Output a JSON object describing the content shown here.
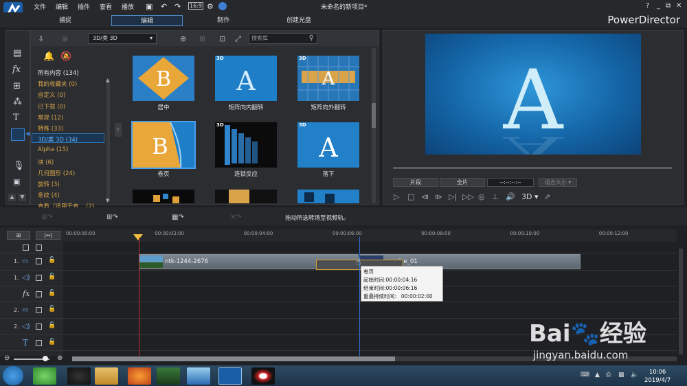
{
  "app": {
    "title": "未命名的新项目*",
    "brand": "PowerDirector"
  },
  "menu": [
    "文件",
    "编辑",
    "插件",
    "查看",
    "播放"
  ],
  "modes": [
    "捕捉",
    "编辑",
    "制作",
    "创建光盘"
  ],
  "window_controls": [
    "?",
    "_",
    "⧉",
    "✕"
  ],
  "library": {
    "category_select": "3D/类 3D",
    "search_placeholder": "搜索库"
  },
  "categories": [
    {
      "label": "所有内容 (134)",
      "selected": false,
      "color": "#e0e0e0"
    },
    {
      "label": "我的收藏夹 (0)",
      "selected": false,
      "color": "#d7a44a"
    },
    {
      "label": "自定义 (0)",
      "selected": false,
      "color": "#d7a44a"
    },
    {
      "label": "已下载 (0)",
      "selected": false,
      "color": "#d7a44a"
    },
    {
      "label": "常规 (12)",
      "selected": false,
      "color": "#d7a44a"
    },
    {
      "label": "特殊 (33)",
      "selected": false,
      "color": "#d7a44a"
    },
    {
      "label": "3D/类 3D (34)",
      "selected": true,
      "color": "#6fb6ff"
    },
    {
      "label": "Alpha (15)",
      "selected": false,
      "color": "#d7a44a"
    },
    {
      "label": "块 (6)",
      "selected": false,
      "color": "#d7a44a"
    },
    {
      "label": "几何图形 (24)",
      "selected": false,
      "color": "#d7a44a"
    },
    {
      "label": "旋转 (3)",
      "selected": false,
      "color": "#d7a44a"
    },
    {
      "label": "条纹 (4)",
      "selected": false,
      "color": "#d7a44a"
    },
    {
      "label": "查看（适用于查... (2)",
      "selected": false,
      "color": "#d7a44a"
    }
  ],
  "transitions": [
    {
      "label": "居中",
      "badge": ""
    },
    {
      "label": "矩阵向内翻转",
      "badge": "3D"
    },
    {
      "label": "矩阵向外翻转",
      "badge": "3D"
    },
    {
      "label": "卷页",
      "badge": ""
    },
    {
      "label": "连锁反应",
      "badge": "3D"
    },
    {
      "label": "落下",
      "badge": "3D"
    }
  ],
  "preview": {
    "clip_btn": "片段",
    "full_btn": "全片",
    "timecode": "--:--:--:--",
    "fit": "适合大小",
    "mode_3d": "3D"
  },
  "timeline": {
    "hint": "拖动所选转场至视频轨。",
    "ruler": [
      "00:00:00:00",
      "00:00:02:00",
      "00:00:04:00",
      "00:00:06:00",
      "00:00:08:00",
      "00:00:10:00",
      "00:00:12:00"
    ],
    "tracks": [
      "1.",
      "1.",
      "",
      "2.",
      "2.",
      "",
      ""
    ],
    "clips": [
      {
        "name": "ntk-1244-2676"
      },
      {
        "name": "sunrise_01"
      }
    ],
    "tooltip": {
      "title": "卷页",
      "start": "起始时间:00:00:04:16",
      "end": "结束时间:00:00:06:16",
      "duration": "重叠持续时间： 00:00:02:00"
    }
  },
  "taskbar": {
    "time": "10:06",
    "date": "2019/4/7"
  },
  "watermark": {
    "brand": "Bai🐾经验",
    "url": "jingyan.baidu.com"
  }
}
